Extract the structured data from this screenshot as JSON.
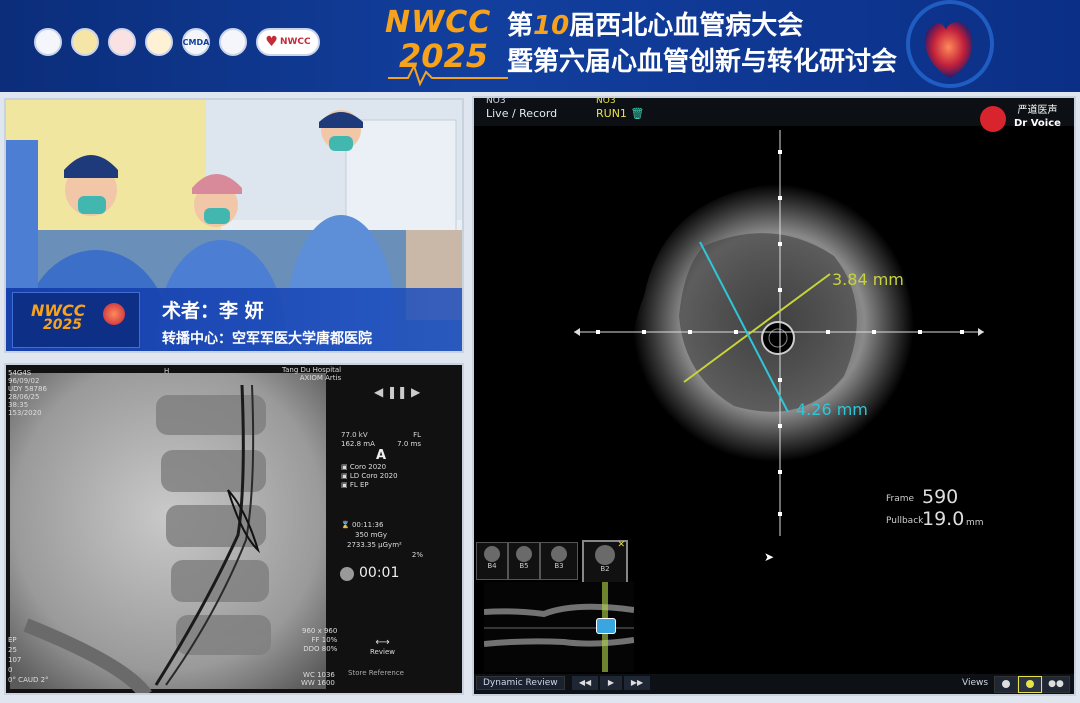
{
  "banner": {
    "logos": [
      "",
      "",
      "",
      "",
      "CMDA",
      "",
      "NWCC"
    ],
    "brand_line1": "NWCC",
    "brand_line2": "2025",
    "title_prefix": "第",
    "title_num": "10",
    "title_suffix": "届西北心血管病大会",
    "subtitle": "暨第六届心血管创新与转化研讨会"
  },
  "video": {
    "logo_line1": "NWCC",
    "logo_line2": "2025",
    "surgeon": "术者：李 妍",
    "center": "转播中心：空军军医大学唐都医院"
  },
  "xray": {
    "header_h": "H",
    "hospital": "Tang Du Hospital",
    "system": "AXIOM Artis",
    "kv": "77.0 kV",
    "fl": "FL",
    "ma": "162.8 mA",
    "ms": "7.0 ms",
    "program_letter": "A",
    "prog1": "Coro 2020",
    "prog2": "LD Coro 2020",
    "prog3": "FL EP",
    "fluoro_time": "00:11:36",
    "dose1": "350 mGy",
    "dose2": "2733.35 µGym²",
    "pct": "2%",
    "timer": "00:01",
    "matrix": "960 x 960",
    "ff": "FF 10%",
    "ddo": "DDO 80%",
    "review": "Review",
    "store": "Store Reference",
    "wc": "WC 1036",
    "ww": "WW 1600",
    "left_codes": [
      "EP",
      "25",
      "107",
      "0",
      "0° CAUD 2°"
    ],
    "left_top": [
      "54G4S",
      "96/09/02",
      "UDY 58786",
      "28/06/25",
      "38:35",
      "153/2020"
    ]
  },
  "ivus": {
    "tab1": "Live / Record",
    "tab2": "RUN1",
    "tab_top": "NO3",
    "watermark": "严道医声",
    "watermark2": "Dr Voice",
    "meas1": "3.84 mm",
    "meas2": "4.26 mm",
    "frame_label": "Frame",
    "frame_value": "590",
    "pullback_label": "Pullback",
    "pullback_value": "19.0",
    "pullback_unit": "mm",
    "thumbs": [
      "B4",
      "B5",
      "B3",
      "B2"
    ],
    "dynamic_review": "Dynamic Review",
    "views": "Views",
    "playback": [
      "◀◀",
      "▶",
      "▶▶"
    ]
  },
  "colors": {
    "banner_bg": "#123f9e",
    "brand_orange": "#f7a21b",
    "measure_yellow": "#c7d43a",
    "measure_cyan": "#2fc6d8",
    "lower_third": "#1f4fb8"
  }
}
